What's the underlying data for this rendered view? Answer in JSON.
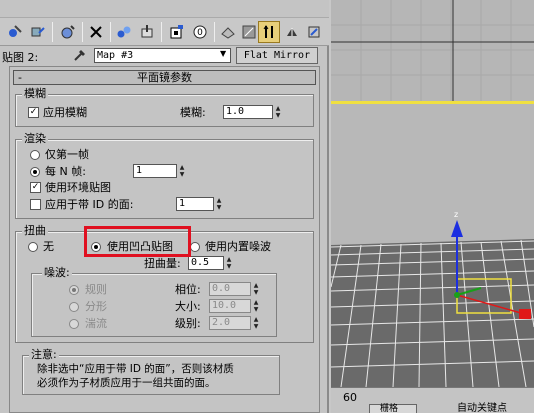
{
  "toolbar": {
    "icons": [
      "pick-material-icon",
      "put-to-scene-icon",
      "assign-material-icon",
      "reset-map-icon",
      "make-unique-icon",
      "put-to-library-icon",
      "material-id-icon",
      "show-map-icon",
      "show-end-result-icon",
      "go-to-parent-icon",
      "go-forward-icon"
    ]
  },
  "map_row": {
    "label": "贴图 2:",
    "map_name": "Map #3",
    "map_type_button": "Flat Mirror"
  },
  "rollout": {
    "minus": "-",
    "title": "平面镜参数"
  },
  "blur": {
    "title": "模糊",
    "apply_blur_label": "应用模糊",
    "apply_blur_checked": true,
    "blur_label": "模糊:",
    "blur_value": "1.0"
  },
  "render": {
    "title": "渲染",
    "first_frame_label": "仅第一帧",
    "every_n_label": "每 N 帧:",
    "every_n_value": "1",
    "every_n_selected": true,
    "env_map_label": "使用环境贴图",
    "env_map_checked": true,
    "apply_id_label": "应用于带 ID 的面:",
    "apply_id_checked": false,
    "apply_id_value": "1"
  },
  "distortion": {
    "title": "扭曲",
    "none_label": "无",
    "bump_label": "使用凹凸贴图",
    "builtin_noise_label": "使用内置噪波",
    "selected": "bump",
    "amount_label": "扭曲量:",
    "amount_value": "0.5"
  },
  "noise": {
    "title": "噪波:",
    "regular_label": "规则",
    "fractal_label": "分形",
    "turbulence_label": "湍流",
    "selected": "regular",
    "phase_label": "相位:",
    "phase_value": "0.0",
    "size_label": "大小:",
    "size_value": "10.0",
    "levels_label": "级别:",
    "levels_value": "2.0"
  },
  "note": {
    "title": "注意:",
    "line1": "除非选中“应用于带 ID 的面”，否则该材质",
    "line2": "必须作为子材质应用于一组共面的面。"
  },
  "statusbar": {
    "frame_value": "60",
    "text1": "栅格",
    "text2": "自动关键点"
  },
  "colors": {
    "highlight": "#e01020",
    "active_button": "#e8cf7a",
    "viewport_border": "#f0e040",
    "axis_z": "#1c2fe0",
    "axis_x": "#e01818"
  }
}
